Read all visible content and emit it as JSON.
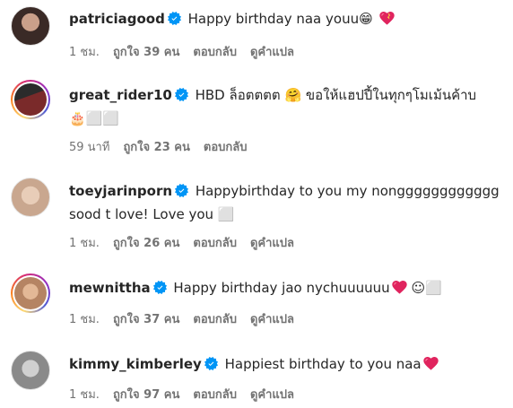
{
  "comments": [
    {
      "username": "patriciagood",
      "text": "Happy birthday naa youu",
      "emoji": "😁",
      "time": "1 ชม.",
      "likes": "ถูกใจ 39 คน",
      "reply": "ตอบกลับ",
      "translate": "ดูคำแปล",
      "avatar_color": "#3a2a26"
    },
    {
      "username": "great_rider10",
      "text": "HBD ล็อตตตต",
      "emoji": "🤗",
      "text2": "ขอให้แฮปปี้ในทุกๆโมเม้นค้าบ",
      "line2_emoji": "🎂",
      "line2_tail": "⬜⬜",
      "time": "59 นาที",
      "likes": "ถูกใจ 23 คน",
      "reply": "ตอบกลับ",
      "avatar_color": "#7a2a2a"
    },
    {
      "username": "toeyjarinporn",
      "text": "Happybirthday to you my nongggggggggggg",
      "text2": "sood t love! Love you",
      "line2_tail": "⬜",
      "time": "1 ชม.",
      "likes": "ถูกใจ 26 คน",
      "reply": "ตอบกลับ",
      "translate": "ดูคำแปล",
      "avatar_color": "#c9a78f"
    },
    {
      "username": "mewnittha",
      "text": "Happy birthday jao nychuuuuuu",
      "tail": "☺⬜",
      "time": "1 ชม.",
      "likes": "ถูกใจ 37 คน",
      "reply": "ตอบกลับ",
      "translate": "ดูคำแปล",
      "avatar_color": "#b58463"
    },
    {
      "username": "kimmy_kimberley",
      "text": "Happiest birthday to you naa",
      "time": "1 ชม.",
      "likes": "ถูกใจ 97 คน",
      "reply": "ตอบกลับ",
      "translate": "ดูคำแปล",
      "avatar_color": "#8a8a8a"
    }
  ],
  "colors": {
    "verified": "#0095f6",
    "heart": "#e0245e",
    "meta": "#737373"
  }
}
